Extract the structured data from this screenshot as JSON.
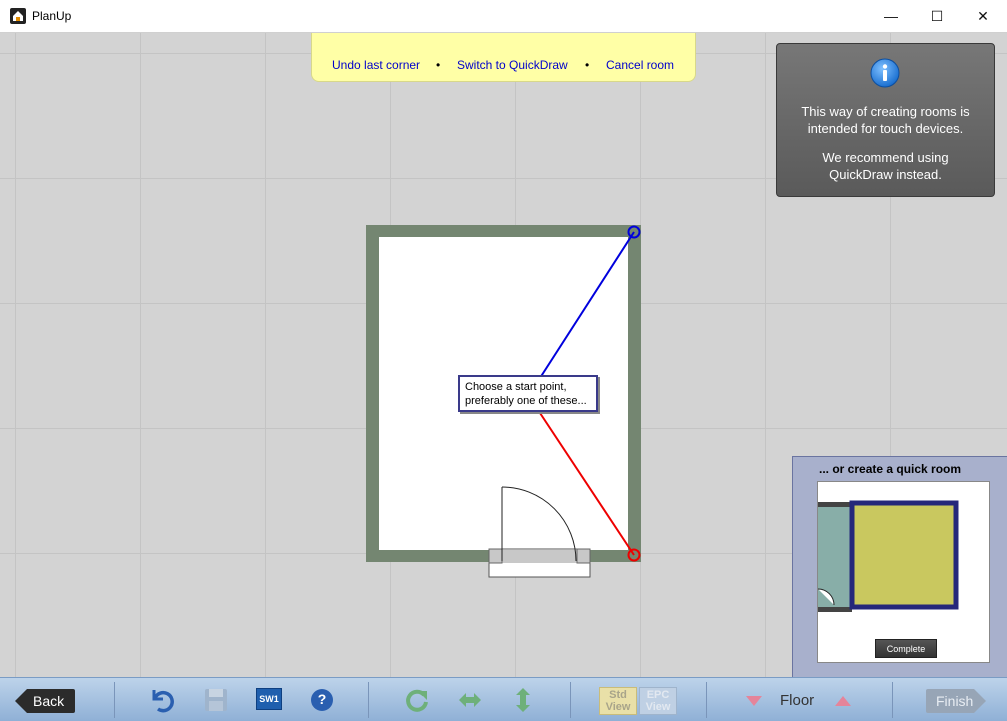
{
  "window": {
    "title": "PlanUp",
    "minimize_glyph": "—",
    "maximize_glyph": "☐",
    "close_glyph": "✕"
  },
  "topbar": {
    "undo_label": "Undo last corner",
    "switch_label": "Switch to QuickDraw",
    "cancel_label": "Cancel room",
    "separator": "•"
  },
  "info": {
    "line1": "This way of creating rooms is",
    "line2": "intended for touch devices.",
    "line3": "We recommend using",
    "line4": "QuickDraw instead.",
    "icon": "info-icon"
  },
  "tooltip": {
    "line1": "Choose a start point,",
    "line2": "preferably one of these..."
  },
  "quickroom": {
    "title": "... or create a quick room",
    "complete_label": "Complete"
  },
  "toolbar": {
    "back_label": "Back",
    "sw1_label": "SW1",
    "help_glyph": "?",
    "std_view_line1": "Std",
    "std_view_line2": "View",
    "epc_view_line1": "EPC",
    "epc_view_line2": "View",
    "floor_label": "Floor",
    "finish_label": "Finish"
  },
  "colors": {
    "wall": "#748671",
    "line_blue": "#0000dd",
    "line_red": "#ee0000",
    "topbar_bg": "#ffffa6",
    "link": "#0000cc",
    "toolbar_bg": "#a9c3e2",
    "quickroom_fill": "#c9c85f",
    "quickroom_border": "#25287a"
  }
}
